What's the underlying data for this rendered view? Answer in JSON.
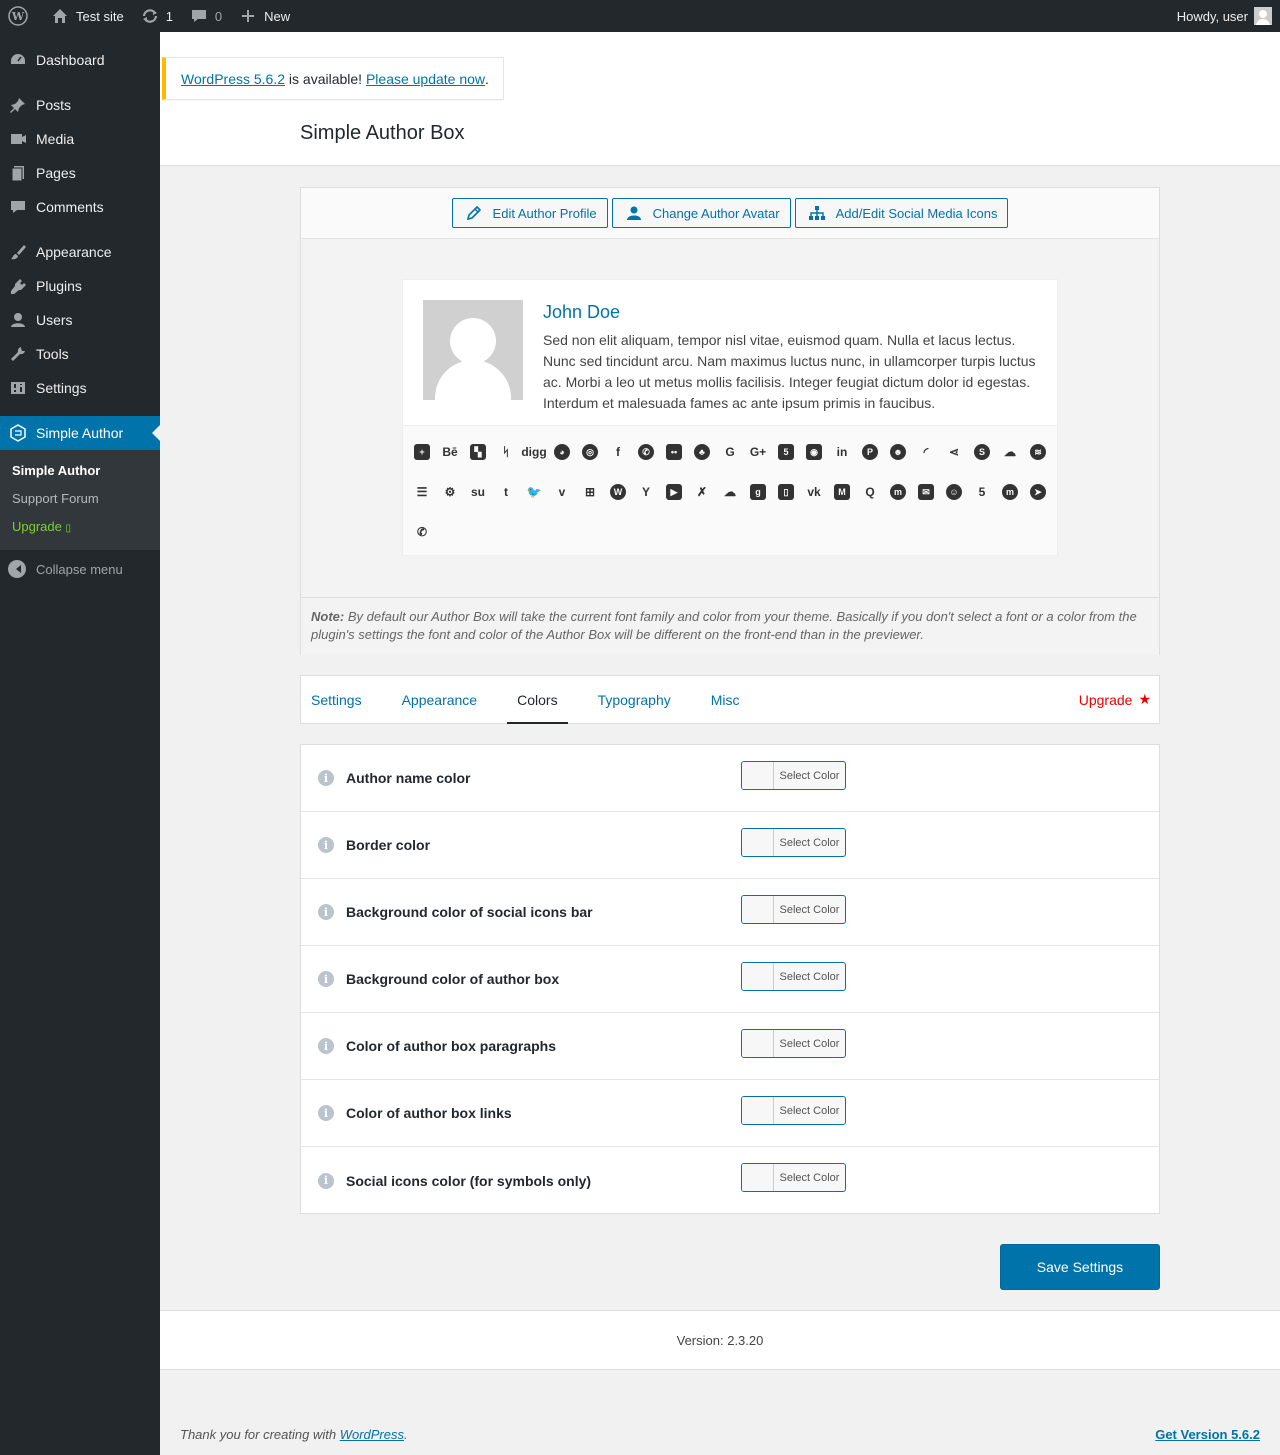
{
  "adminbar": {
    "site_name": "Test site",
    "updates_count": "1",
    "comments_count": "0",
    "new_label": "New",
    "greeting": "Howdy, user"
  },
  "sidebar": {
    "items": [
      {
        "label": "Dashboard",
        "icon": "dashboard-icon"
      },
      {
        "label": "Posts",
        "icon": "pin-icon"
      },
      {
        "label": "Media",
        "icon": "media-icon"
      },
      {
        "label": "Pages",
        "icon": "pages-icon"
      },
      {
        "label": "Comments",
        "icon": "comment-icon"
      },
      {
        "label": "Appearance",
        "icon": "brush-icon"
      },
      {
        "label": "Plugins",
        "icon": "plug-icon"
      },
      {
        "label": "Users",
        "icon": "user-icon"
      },
      {
        "label": "Tools",
        "icon": "wrench-icon"
      },
      {
        "label": "Settings",
        "icon": "sliders-icon"
      },
      {
        "label": "Simple Author",
        "icon": "author-box-icon"
      }
    ],
    "submenu": [
      "Simple Author",
      "Support Forum",
      "Upgrade"
    ],
    "collapse_label": "Collapse menu"
  },
  "notice": {
    "link_version": "WordPress 5.6.2",
    "middle_text": " is available! ",
    "link_update": "Please update now",
    "end_text": "."
  },
  "page_title": "Simple Author Box",
  "toolbar": {
    "edit_profile": "Edit Author Profile",
    "change_avatar": "Change Author Avatar",
    "social_icons": "Add/Edit Social Media Icons"
  },
  "author": {
    "name": "John Doe",
    "bio": "Sed non elit aliquam, tempor nisl vitae, euismod quam. Nulla et lacus lectus. Nunc sed tincidunt arcu. Nam maximus luctus nunc, in ullamcorper turpis luctus ac. Morbi a leo ut metus mollis facilisis. Integer feugiat dictum dolor id egestas. Interdum et malesuada fames ac ante ipsum primis in faucibus."
  },
  "social_icons": [
    "addthis-icon",
    "behance-icon",
    "delicious-icon",
    "deviantart-icon",
    "digg-icon",
    "discord-icon",
    "dribbble-icon",
    "facebook-icon",
    "whatsapp-icon",
    "flickr-icon",
    "github-icon",
    "google-icon",
    "googleplus-icon",
    "html5-icon",
    "instagram-icon",
    "linkedin-icon",
    "pinterest-icon",
    "reddit-icon",
    "rss-icon",
    "sharethis-icon",
    "skype-icon",
    "soundcloud-icon",
    "spotify-icon",
    "stackoverflow-icon",
    "steam-icon",
    "stumbleupon-icon",
    "tumblr-icon",
    "twitter-icon",
    "vimeo-icon",
    "windows-icon",
    "wordpress-icon",
    "yahoo-icon",
    "youtube-icon",
    "xing-icon",
    "mixcloud-icon",
    "goodreads-icon",
    "twitch-icon",
    "vk-icon",
    "medium-icon",
    "quora-icon",
    "meetup-icon",
    "email-icon",
    "snapchat-icon",
    "500px-icon",
    "mastodon-icon",
    "telegram-icon",
    "phone-icon"
  ],
  "note": {
    "label": "Note:",
    "text": " By default our Author Box will take the current font family and color from your theme. Basically if you don't select a font or a color from the plugin's settings the font and color of the Author Box will be different on the front-end than in the previewer."
  },
  "tabs": [
    {
      "label": "Settings"
    },
    {
      "label": "Appearance"
    },
    {
      "label": "Colors"
    },
    {
      "label": "Typography"
    },
    {
      "label": "Misc"
    }
  ],
  "active_tab": "Colors",
  "upgrade_label": "Upgrade",
  "color_settings": [
    {
      "label": "Author name color",
      "button": "Select Color"
    },
    {
      "label": "Border color",
      "button": "Select Color"
    },
    {
      "label": "Background color of social icons bar",
      "button": "Select Color"
    },
    {
      "label": "Background color of author box",
      "button": "Select Color"
    },
    {
      "label": "Color of author box paragraphs",
      "button": "Select Color"
    },
    {
      "label": "Color of author box links",
      "button": "Select Color"
    },
    {
      "label": "Social icons color (for symbols only)",
      "button": "Select Color"
    }
  ],
  "save_label": "Save Settings",
  "version_text": "Version: 2.3.20",
  "footer": {
    "thanks_prefix": "Thank you for creating with ",
    "thanks_link": "WordPress",
    "thanks_suffix": ".",
    "get_version": "Get Version 5.6.2"
  },
  "colors": {
    "accent": "#0073aa",
    "sidebar_bg": "#23282d",
    "notice_border": "#ffb900",
    "upgrade_green": "#7ad03a",
    "upgrade_red": "#e00000"
  }
}
